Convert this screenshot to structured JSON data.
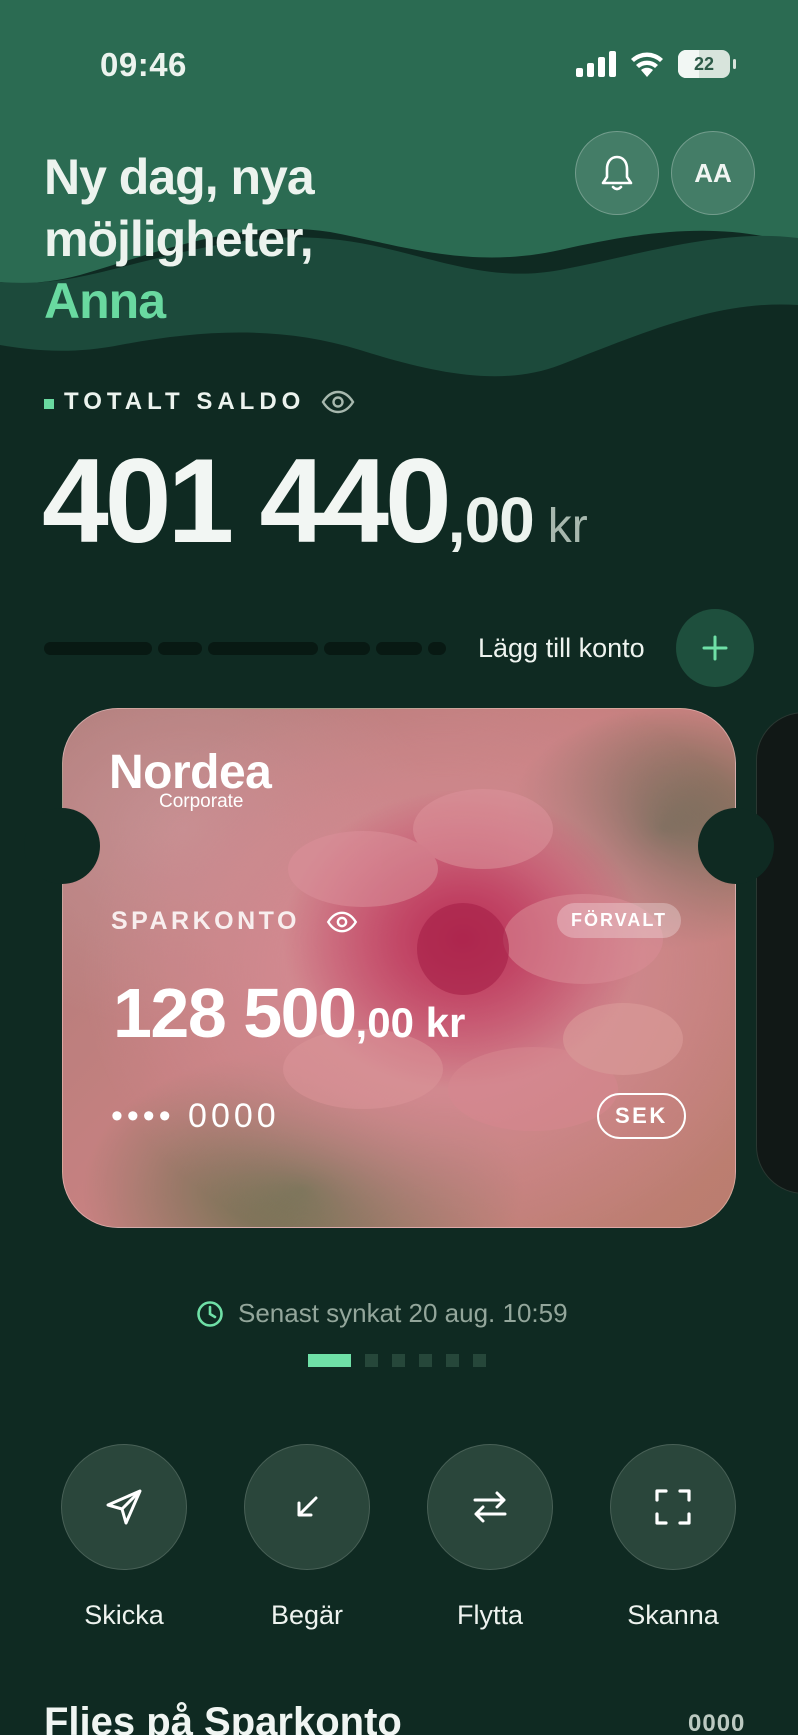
{
  "status_bar": {
    "time": "09:46",
    "battery": "22"
  },
  "header": {
    "greeting_line1": "Ny dag, nya",
    "greeting_line2": "möjligheter,",
    "name": "Anna",
    "avatar_initials": "AA"
  },
  "total": {
    "label": "TOTALT SALDO",
    "amount_int": "401 440",
    "amount_dec": ",00",
    "currency": "kr"
  },
  "accounts_bar": {
    "add_label": "Lägg till konto"
  },
  "card": {
    "brand": "Nordea",
    "brand_sub": "Corporate",
    "account_type": "SPARKONTO",
    "badge": "FÖRVALT",
    "amount_int": "128 500",
    "amount_dec": ",00 kr",
    "masked_number": "•••• 0000",
    "currency": "SEK"
  },
  "sync": {
    "text": "Senast synkat 20 aug. 10:59"
  },
  "pagination": {
    "total": 6,
    "active": 1
  },
  "actions": [
    {
      "label": "Skicka",
      "icon": "send-icon"
    },
    {
      "label": "Begär",
      "icon": "arrow-down-left-icon"
    },
    {
      "label": "Flytta",
      "icon": "swap-arrows-icon"
    },
    {
      "label": "Skanna",
      "icon": "scan-icon"
    }
  ],
  "section": {
    "title": "Flies på Sparkonto",
    "number": "0000"
  },
  "colors": {
    "accent": "#69d9a0",
    "background": "#0f2a22",
    "hero": "#2b6b52"
  }
}
